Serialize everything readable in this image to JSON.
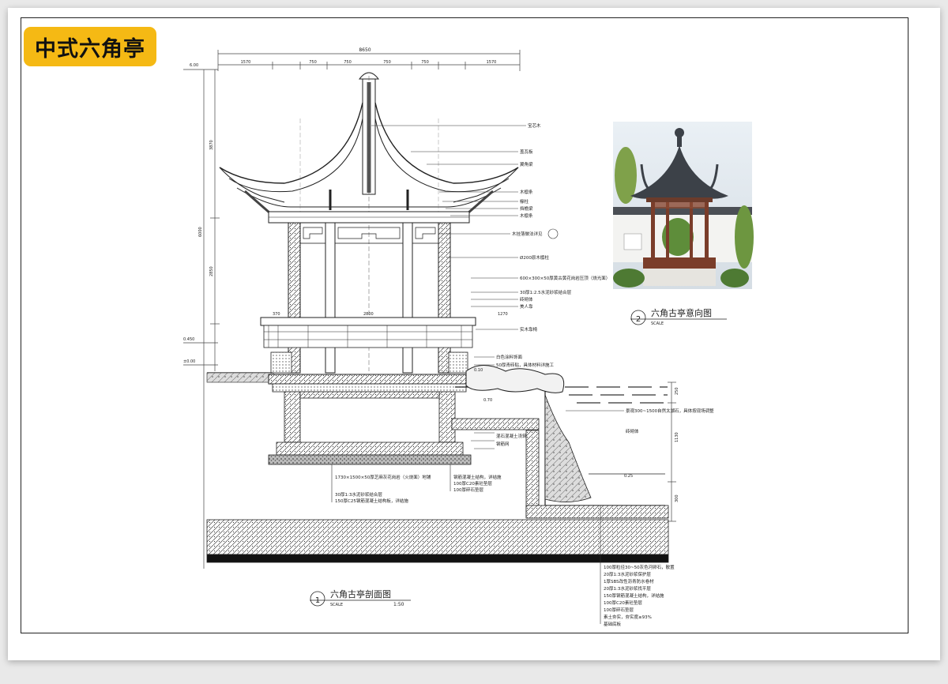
{
  "title_badge": "中式六角亭",
  "dimensions": {
    "overall_width": "8650",
    "top_segments": [
      "1570",
      "750",
      "750",
      "750",
      "750",
      "1570"
    ],
    "height_total": "6000",
    "height_upper": "3870",
    "height_lower": "2850",
    "plinth_left": "370",
    "plinth_mid": "2800",
    "plinth_right": "1270",
    "water_height_a": "250",
    "water_height_b": "1130",
    "water_height_c": "300"
  },
  "levels": {
    "top_level": "6.00",
    "floor_level": "0.450",
    "ground_level": "±0.00",
    "level_a": "0.70",
    "level_b": "0.25",
    "level_c": "0.10"
  },
  "labels_upper": [
    "宝芯木",
    "盖瓦板",
    "翼角梁",
    "木檩条",
    "椽柱",
    "挡檐梁",
    "木檩条",
    "木挂落做法详见",
    "Ø200原木檩柱",
    "600×300×50厚黄古黄花岗岩压顶（烧光面）",
    "30厚1:2.5水泥砂浆结合层",
    "砖砌体",
    "美人靠",
    "实木靠椅"
  ],
  "labels_mid": [
    "白色涂料饰面",
    "50厚青砖贴，具体材料详施工",
    "景观300~1500自然太湖石，具体按现场调整",
    "砖砌体",
    "混石混凝土浇筑",
    "钢筋网"
  ],
  "labels_base_left": [
    "1730×1500×50厚芝麻灰花岗岩（火烧面）地铺",
    "30厚1:3水泥砂浆结合层",
    "150厚C25钢筋混凝土结构板，详结施"
  ],
  "labels_base_mid": [
    "钢筋混凝土结构，详结施",
    "100厚C20素砼垫层",
    "100厚碎石垫层"
  ],
  "labels_bottom": [
    "100厚粒径30~50灰色河卵石，散置",
    "20厚1:3水泥砂浆保护层",
    "1厚SBS改性沥青防水卷材",
    "20厚1:3水泥砂浆找平层",
    "150厚钢筋混凝土结构，详结施",
    "100厚C20素砼垫层",
    "100厚碎石垫层",
    "素土夯实，夯实度≥93%",
    "基础底板"
  ],
  "section_caption": {
    "number": "1",
    "title": "六角古亭剖面图",
    "scale_word": "SCALE",
    "scale_value": "1:50"
  },
  "photo_caption": {
    "number": "2",
    "title": "六角古亭意向图",
    "scale_word": "SCALE"
  },
  "colors": {
    "badge": "#f5b914",
    "line": "#222222",
    "sky": "#dfe7ef",
    "roof": "#3c4148",
    "column": "#7a3d2a"
  }
}
